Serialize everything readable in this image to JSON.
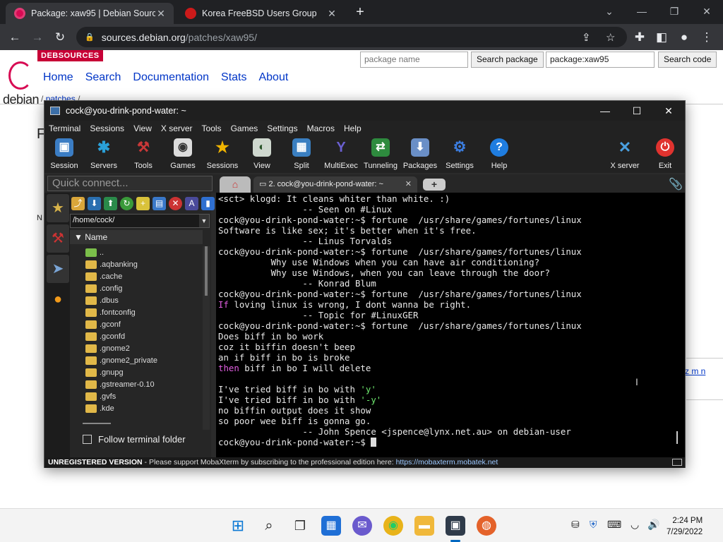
{
  "browser": {
    "tabs": [
      {
        "title": "Package: xaw95 | Debian Sources",
        "active": true
      },
      {
        "title": "Korea FreeBSD Users Group",
        "active": false
      }
    ],
    "new_tab": "+",
    "url_host": "sources.debian.org",
    "url_path": "/patches/xaw95/"
  },
  "debian_page": {
    "brand": "DEBSOURCES",
    "logo_word": "debian",
    "nav": [
      "Home",
      "Search",
      "Documentation",
      "Stats",
      "About"
    ],
    "package_search_placeholder": "package name",
    "package_search_button": "Search package",
    "code_search_value": "package:xaw95",
    "code_search_button": "Search code",
    "breadcrumb_sep": "/",
    "breadcrumb_link": "patches",
    "breadcrumb_tail": "/",
    "heading_fragment": "F",
    "side_fragment": "N",
    "side_links": "z m n"
  },
  "moba": {
    "title": "cock@you-drink-pond-water: ~",
    "menu": [
      "Terminal",
      "Sessions",
      "View",
      "X server",
      "Tools",
      "Games",
      "Settings",
      "Macros",
      "Help"
    ],
    "tools": [
      {
        "label": "Session",
        "icon": "monitor-icon",
        "color": "#3b7dc4",
        "glyph": "▣"
      },
      {
        "label": "Servers",
        "icon": "servers-icon",
        "color": "#2aa0d8",
        "glyph": "✱"
      },
      {
        "label": "Tools",
        "icon": "tools-icon",
        "color": "#c93838",
        "glyph": "⚒"
      },
      {
        "label": "Games",
        "icon": "gamepad-icon",
        "color": "#666666",
        "glyph": "◉"
      },
      {
        "label": "Sessions",
        "icon": "star-icon",
        "color": "#e0a800",
        "glyph": "★"
      },
      {
        "label": "View",
        "icon": "user-view-icon",
        "color": "#4d7a4d",
        "glyph": "◐"
      },
      {
        "label": "Split",
        "icon": "split-icon",
        "color": "#3a7fc1",
        "glyph": "▦"
      },
      {
        "label": "MultiExec",
        "icon": "multiexec-icon",
        "color": "#5a4db0",
        "glyph": "Y"
      },
      {
        "label": "Tunneling",
        "icon": "tunneling-icon",
        "color": "#2e8b3e",
        "glyph": "⇄"
      },
      {
        "label": "Packages",
        "icon": "packages-icon",
        "color": "#6a8fc7",
        "glyph": "⬇"
      },
      {
        "label": "Settings",
        "icon": "gears-icon",
        "color": "#2f67c4",
        "glyph": "⚙"
      },
      {
        "label": "Help",
        "icon": "help-icon",
        "color": "#1f7de0",
        "glyph": "?"
      }
    ],
    "xserver_label": "X server",
    "exit_label": "Exit",
    "quick_connect_placeholder": "Quick connect...",
    "terminal_tab": "2. cock@you-drink-pond-water: ~",
    "path": "/home/cock/",
    "tree_header": "Name",
    "files": [
      "..",
      ".aqbanking",
      ".cache",
      ".config",
      ".dbus",
      ".fontconfig",
      ".gconf",
      ".gconfd",
      ".gnome2",
      ".gnome2_private",
      ".gnupg",
      ".gstreamer-0.10",
      ".gvfs",
      ".kde"
    ],
    "follow_folder": "Follow terminal folder",
    "terminal_lines": [
      [
        {
          "t": "<sct> klogd: It cleans whiter than white. :)"
        }
      ],
      [
        {
          "t": "                -- Seen on #Linux"
        }
      ],
      [
        {
          "t": "cock@you-drink-pond-water:~$ fortune  /usr/share/games/fortunes/linux"
        }
      ],
      [
        {
          "t": "Software is like sex; it's better when it's free."
        }
      ],
      [
        {
          "t": "                -- Linus Torvalds"
        }
      ],
      [
        {
          "t": "cock@you-drink-pond-water:~$ fortune  /usr/share/games/fortunes/linux"
        }
      ],
      [
        {
          "t": "          Why use Windows when you can have air conditioning?"
        }
      ],
      [
        {
          "t": "          Why use Windows, when you can leave through the door?"
        }
      ],
      [
        {
          "t": "                -- Konrad Blum"
        }
      ],
      [
        {
          "t": "cock@you-drink-pond-water:~$ fortune  /usr/share/games/fortunes/linux"
        }
      ],
      [
        {
          "t": "If",
          "c": "mg"
        },
        {
          "t": " loving linux is wrong, I dont wanna be right."
        }
      ],
      [
        {
          "t": "                -- Topic for #LinuxGER"
        }
      ],
      [
        {
          "t": "cock@you-drink-pond-water:~$ fortune  /usr/share/games/fortunes/linux"
        }
      ],
      [
        {
          "t": "Does biff in bo work"
        }
      ],
      [
        {
          "t": "coz it biffin doesn't beep"
        }
      ],
      [
        {
          "t": "an if biff in bo is broke"
        }
      ],
      [
        {
          "t": "then",
          "c": "mg"
        },
        {
          "t": " biff in bo I will delete"
        }
      ],
      [
        {
          "t": ""
        }
      ],
      [
        {
          "t": "I've tried biff in bo with "
        },
        {
          "t": "'y'",
          "c": "gr"
        }
      ],
      [
        {
          "t": "I've tried biff in bo with "
        },
        {
          "t": "'-y'",
          "c": "gr"
        }
      ],
      [
        {
          "t": "no biffin output does it show"
        }
      ],
      [
        {
          "t": "so poor wee biff is gonna go."
        }
      ],
      [
        {
          "t": "                -- John Spence <jspence@lynx.net.au> on debian-user"
        }
      ],
      [
        {
          "t": "cock@you-drink-pond-water:~$ "
        }
      ]
    ],
    "status_bold": "UNREGISTERED VERSION",
    "status_text": "  -  Please support MobaXterm by subscribing to the professional edition here:  ",
    "status_url": "https://mobaxterm.mobatek.net"
  },
  "taskbar": {
    "time": "2:24 PM",
    "date": "7/29/2022"
  }
}
